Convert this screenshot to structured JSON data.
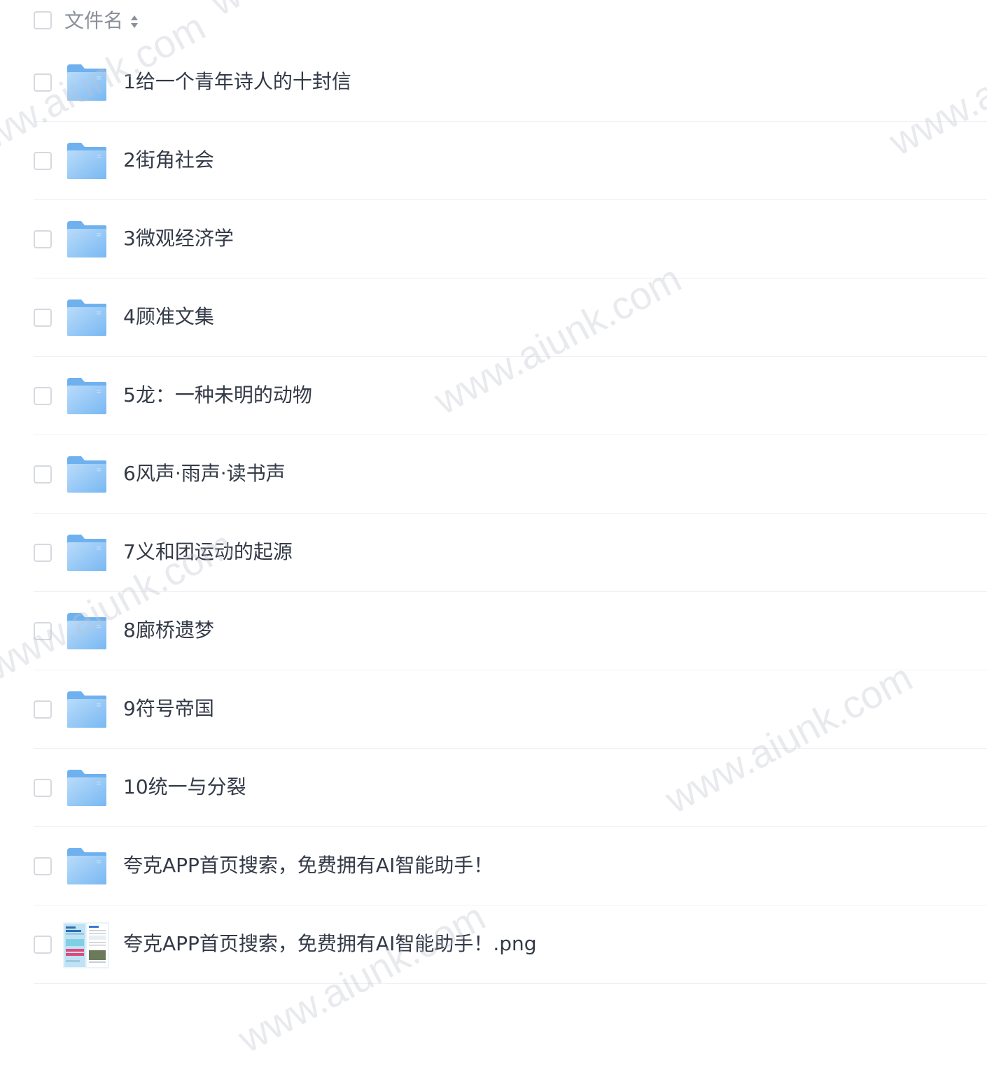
{
  "header": {
    "column_label": "文件名"
  },
  "files": [
    {
      "name": "1给一个青年诗人的十封信",
      "icon": "folder-icon"
    },
    {
      "name": "2街角社会",
      "icon": "folder-icon"
    },
    {
      "name": "3微观经济学",
      "icon": "folder-icon"
    },
    {
      "name": "4顾准文集",
      "icon": "folder-icon"
    },
    {
      "name": "5龙：一种未明的动物",
      "icon": "folder-icon"
    },
    {
      "name": "6风声·雨声·读书声",
      "icon": "folder-icon"
    },
    {
      "name": "7义和团运动的起源",
      "icon": "folder-icon"
    },
    {
      "name": "8廊桥遗梦",
      "icon": "folder-icon"
    },
    {
      "name": "9符号帝国",
      "icon": "folder-icon"
    },
    {
      "name": "10统一与分裂",
      "icon": "folder-icon"
    },
    {
      "name": "夸克APP首页搜索，免费拥有AI智能助手！",
      "icon": "folder-icon"
    },
    {
      "name": "夸克APP首页搜索，免费拥有AI智能助手！.png",
      "icon": "image-thumbnail-icon"
    }
  ],
  "watermark": {
    "text": "www.aiunk.com",
    "color": "#bec3cd"
  },
  "colors": {
    "folder_main": "#8cc4f6",
    "folder_tab": "#6fb1ef",
    "text": "#333a47",
    "muted": "#8a8f99",
    "border": "#d6d9de"
  }
}
